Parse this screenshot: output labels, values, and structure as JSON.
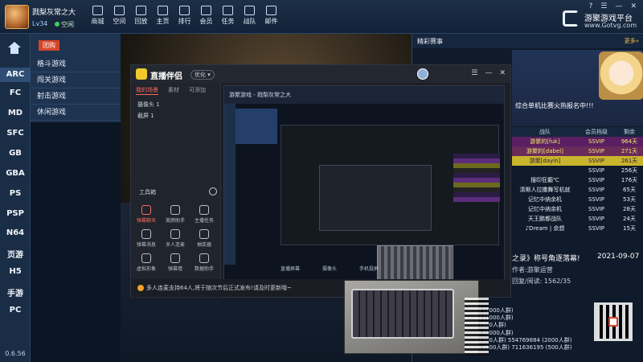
{
  "user": {
    "name": "戮梨灰常之大",
    "level": "Lv34",
    "status": "空闲"
  },
  "nav": [
    "商城",
    "空间",
    "回放",
    "主页",
    "排行",
    "会员",
    "任务",
    "战队",
    "邮件"
  ],
  "window_controls": [
    "?",
    "☰",
    "—",
    "✕"
  ],
  "brand": {
    "name": "游聚游戏平台",
    "url": "www.Gotvg.com"
  },
  "sidebar": {
    "items": [
      "ARC",
      "FC",
      "MD",
      "SFC",
      "GB",
      "GBA",
      "PS",
      "PSP",
      "N64",
      "页游",
      "H5",
      "手游",
      "PC"
    ],
    "version": "0.6.56"
  },
  "categories": {
    "tab": "团购",
    "items": [
      "格斗游戏",
      "闯关游戏",
      "射击游戏",
      "休闲游戏"
    ]
  },
  "stream_app": {
    "title": "直播伴侣",
    "badge": "优化 ▾",
    "tabs": [
      "我的场景",
      "素材",
      "可添加"
    ],
    "scenes": [
      "摄像头 1",
      "截屏 1"
    ],
    "toolbox": "工具箱",
    "tools": [
      [
        "弹幕聊天",
        "美颜助手",
        "主播任务"
      ],
      [
        "弹幕消息",
        "多人连麦",
        "抽奖器"
      ],
      [
        "虚拟形象",
        "弹幕墙",
        "数据助手"
      ]
    ],
    "notice": "多人连麦支持64人,将于随次节后正式发布!请及时更新哦~",
    "preview_title": "游聚游戏 - 戮梨灰常之大",
    "preview_controls": [
      "直播屏幕",
      "摄像头",
      "手机投屏"
    ]
  },
  "right": {
    "section_title": "精彩赛事",
    "more": "更多»",
    "banner_text": "综合单机比赛火热报名中!!!",
    "table_headers": [
      "战队",
      "会员档级",
      "剩余"
    ],
    "rows": [
      {
        "name": "游聚的[fuk]",
        "lv": "SSVIP",
        "days": "964天"
      },
      {
        "name": "游聚的[dabel]",
        "lv": "SSVIP",
        "days": "271天"
      },
      {
        "name": "游聚[dayin]",
        "lv": "SSVIP",
        "days": "261天"
      },
      {
        "name": "",
        "lv": "SSVIP",
        "days": "256天"
      },
      {
        "name": "搜印狂癫℃",
        "lv": "SSVIP",
        "days": "176天"
      },
      {
        "name": "清晰人拉撒舞写机就",
        "lv": "SSVIP",
        "days": "65天"
      },
      {
        "name": "记忆中纳余机",
        "lv": "SSVIP",
        "days": "53天"
      },
      {
        "name": "记忆中纳余机",
        "lv": "SSVIP",
        "days": "28天"
      },
      {
        "name": "天王鹏都战队",
        "lv": "SSVIP",
        "days": "24天"
      },
      {
        "name": "♪Dream | 余想",
        "lv": "SSVIP",
        "days": "15天"
      }
    ],
    "post": {
      "title": "之录》称号角逐落幕!",
      "date": "2021-09-07",
      "author": "作者:游聚运营",
      "stats": "回复/阅读: 1562/35"
    },
    "groups": [
      "179597935 (1000人群)",
      "179937740 (1000人群)",
      "41553042 (500人群)",
      "571479551 (2000人群)",
      "1477782 (1000人群) 554769884 (2000人群)",
      "572748981 (500人群) 711636195 (500人群)"
    ]
  }
}
